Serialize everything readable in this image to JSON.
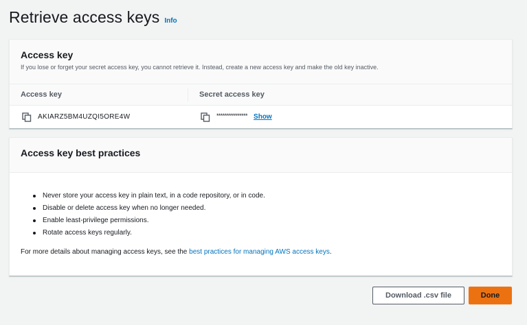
{
  "page": {
    "title": "Retrieve access keys",
    "info_label": "Info"
  },
  "access_key_panel": {
    "title": "Access key",
    "description": "If you lose or forget your secret access key, you cannot retrieve it. Instead, create a new access key and make the old key inactive.",
    "columns": [
      "Access key",
      "Secret access key"
    ],
    "access_key_value": "AKIARZ5BM4UZQI5ORE4W",
    "secret_masked": "***************",
    "show_label": "Show"
  },
  "best_practices_panel": {
    "title": "Access key best practices",
    "items": [
      "Never store your access key in plain text, in a code repository, or in code.",
      "Disable or delete access key when no longer needed.",
      "Enable least-privilege permissions.",
      "Rotate access keys regularly."
    ],
    "footer_prefix": "For more details about managing access keys, see the ",
    "footer_link": "best practices for managing AWS access keys",
    "footer_suffix": "."
  },
  "actions": {
    "download_label": "Download .csv file",
    "done_label": "Done"
  },
  "icons": {
    "copy": "copy-icon"
  },
  "colors": {
    "link": "#0073bb",
    "primary": "#ec7211",
    "background": "#f2f3f3"
  }
}
